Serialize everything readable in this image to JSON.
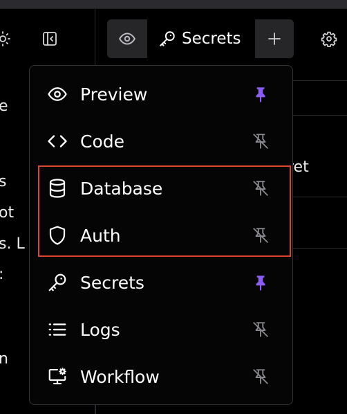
{
  "toolbar": {
    "tabs": [
      {
        "label": "",
        "icon": "eye-icon"
      },
      {
        "label": "Secrets",
        "icon": "key-icon"
      },
      {
        "label": "",
        "icon": "plus-icon"
      }
    ]
  },
  "background_text": {
    "left": [
      "e",
      "s",
      "ot",
      "s. L",
      ":",
      "n"
    ],
    "right": [
      "ret"
    ]
  },
  "menu": {
    "items": [
      {
        "label": "Preview",
        "icon": "eye-icon",
        "pinned": true
      },
      {
        "label": "Code",
        "icon": "code-icon",
        "pinned": false
      },
      {
        "label": "Database",
        "icon": "database-icon",
        "pinned": false
      },
      {
        "label": "Auth",
        "icon": "shield-icon",
        "pinned": false
      },
      {
        "label": "Secrets",
        "icon": "key-icon",
        "pinned": true
      },
      {
        "label": "Logs",
        "icon": "list-icon",
        "pinned": false
      },
      {
        "label": "Workflow",
        "icon": "monitor-gear-icon",
        "pinned": false
      }
    ]
  },
  "colors": {
    "pinned": "#8b5cf6",
    "unpinned": "#8a8a90",
    "highlight": "#e0452e"
  }
}
